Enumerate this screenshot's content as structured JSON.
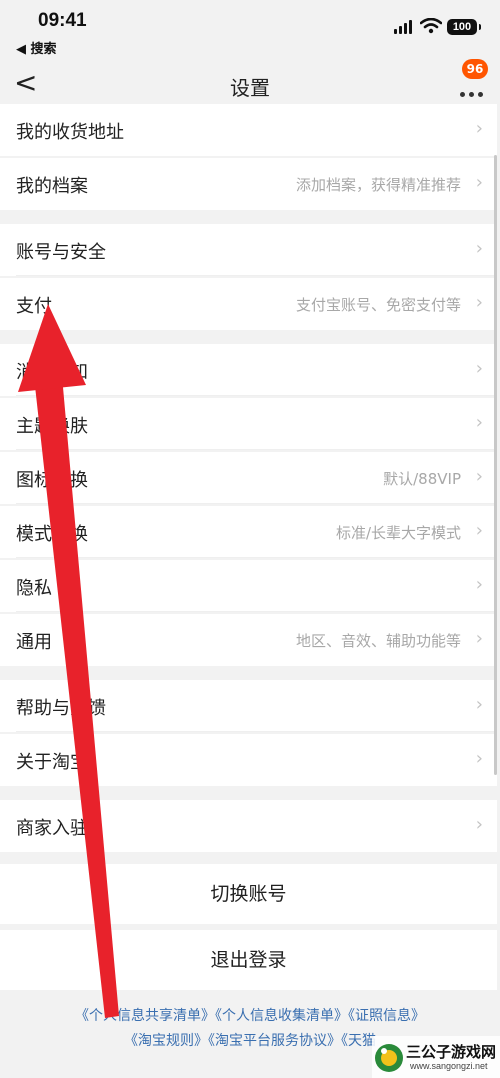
{
  "status_bar": {
    "time": "09:41",
    "back_app": "◀ 搜索",
    "battery": "100"
  },
  "nav": {
    "back_glyph": "<",
    "title": "设置",
    "badge": "96"
  },
  "menu": [
    {
      "label": "我的收货地址",
      "hint": ""
    },
    {
      "label": "我的档案",
      "hint": "添加档案，获得精准推荐"
    },
    {
      "label": "账号与安全",
      "hint": ""
    },
    {
      "label": "支付",
      "hint": "支付宝账号、免密支付等"
    },
    {
      "label": "消息通知",
      "hint": ""
    },
    {
      "label": "主题换肤",
      "hint": ""
    },
    {
      "label": "图标切换",
      "hint": "默认/88VIP"
    },
    {
      "label": "模式切换",
      "hint": "标准/长辈大字模式"
    },
    {
      "label": "隐私",
      "hint": ""
    },
    {
      "label": "通用",
      "hint": "地区、音效、辅助功能等"
    },
    {
      "label": "帮助与反馈",
      "hint": ""
    },
    {
      "label": "关于淘宝",
      "hint": ""
    },
    {
      "label": "商家入驻",
      "hint": ""
    }
  ],
  "actions": {
    "switch_account": "切换账号",
    "logout": "退出登录"
  },
  "footer_links": {
    "line1": [
      "《个人信息共享清单》",
      "《个人信息收集清单》",
      "《证照信息》"
    ],
    "line2": [
      "《淘宝规则》",
      "《淘宝平台服务协议》",
      "《天猫"
    ]
  },
  "watermark": {
    "title": "三公子游戏网",
    "url": "www.sangongzi.net"
  },
  "colors": {
    "badge": "#ff5500",
    "arrow": "#e8222b",
    "link": "#3a6fb0"
  }
}
